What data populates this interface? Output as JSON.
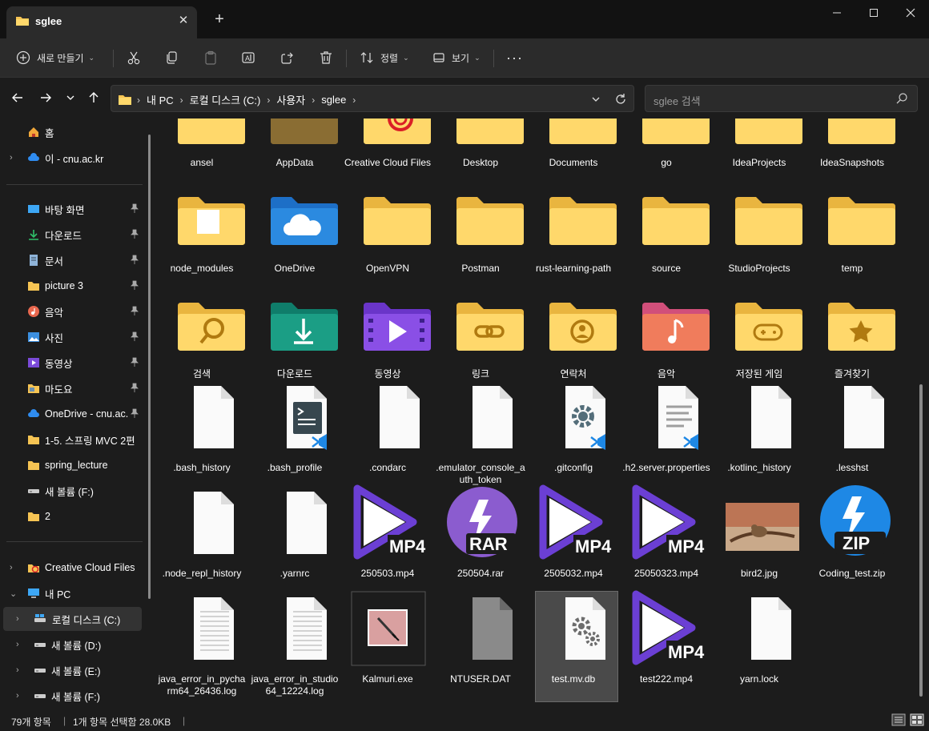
{
  "tab": {
    "title": "sglee"
  },
  "toolbar": {
    "new_label": "새로 만들기",
    "sort_label": "정렬",
    "view_label": "보기"
  },
  "address": {
    "crumbs": [
      "내 PC",
      "로컬 디스크 (C:)",
      "사용자",
      "sglee"
    ]
  },
  "search": {
    "placeholder": "sglee 검색"
  },
  "sidebar": {
    "home": "홈",
    "cloud": "이 - cnu.ac.kr",
    "quick": [
      "바탕 화면",
      "다운로드",
      "문서",
      "picture 3",
      "음악",
      "사진",
      "동영상",
      "마도요",
      "OneDrive - cnu.ac.kr",
      "1-5. 스프링 MVC 2편",
      "spring_lecture",
      "새 볼륨 (F:)",
      "2"
    ],
    "ccf": "Creative Cloud Files",
    "thispc": "내 PC",
    "drives": [
      "로컬 디스크 (C:)",
      "새 볼륨 (D:)",
      "새 볼륨 (E:)",
      "새 볼륨 (F:)"
    ]
  },
  "files": {
    "row1": [
      "ansel",
      "AppData",
      "Creative Cloud Files",
      "Desktop",
      "Documents",
      "go",
      "IdeaProjects",
      "IdeaSnapshots"
    ],
    "row2": [
      "node_modules",
      "OneDrive",
      "OpenVPN",
      "Postman",
      "rust-learning-path",
      "source",
      "StudioProjects",
      "temp"
    ],
    "row3": [
      "검색",
      "다운로드",
      "동영상",
      "링크",
      "연락처",
      "음악",
      "저장된 게임",
      "즐겨찾기"
    ],
    "row4": [
      ".bash_history",
      ".bash_profile",
      ".condarc",
      ".emulator_console_auth_token",
      ".gitconfig",
      ".h2.server.properties",
      ".kotlinc_history",
      ".lesshst"
    ],
    "row5": [
      ".node_repl_history",
      ".yarnrc",
      "250503.mp4",
      "250504.rar",
      "2505032.mp4",
      "25050323.mp4",
      "bird2.jpg",
      "Coding_test.zip"
    ],
    "row6": [
      "java_error_in_pycharm64_26436.log",
      "java_error_in_studio64_12224.log",
      "Kalmuri.exe",
      "NTUSER.DAT",
      "test.mv.db",
      "test222.mp4",
      "yarn.lock"
    ]
  },
  "badges": {
    "mp4": "MP4",
    "rar": "RAR",
    "zip": "ZIP"
  },
  "status": {
    "count": "79개 항목",
    "selection": "1개 항목 선택함 28.0KB"
  },
  "colors": {
    "folder": "#f6c453",
    "accent": "#0a84ff",
    "video": "#6b3fd4"
  }
}
